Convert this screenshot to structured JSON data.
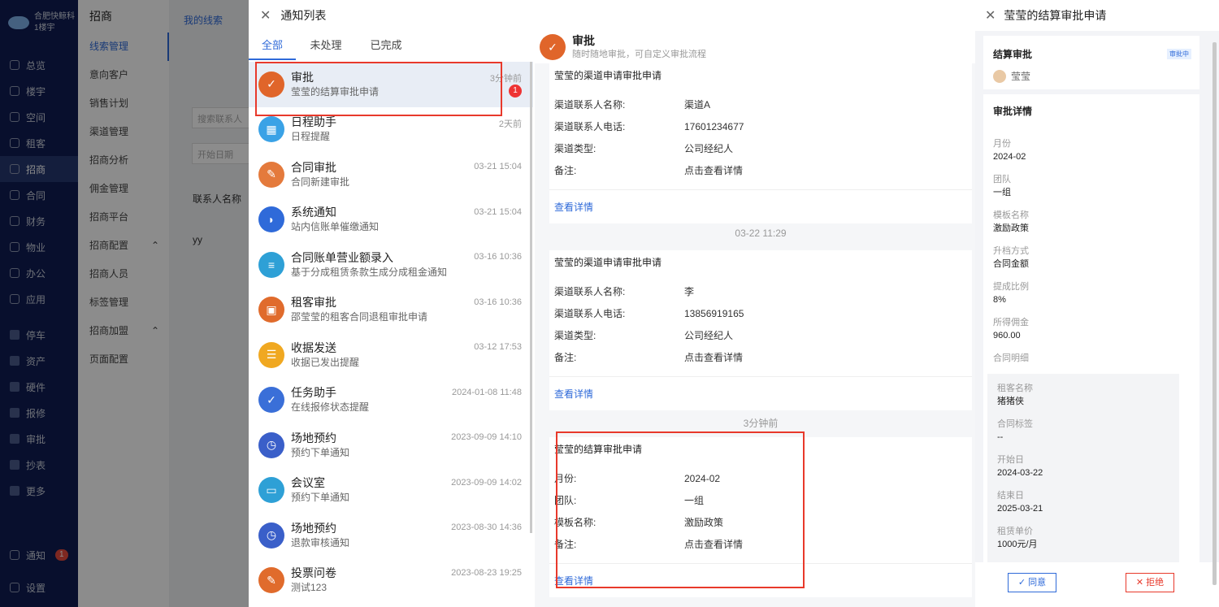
{
  "sidebar": {
    "org": "合肥快鲸科",
    "sub": "1楼宇",
    "items": [
      {
        "label": "总览",
        "icon": "dashboard-icon"
      },
      {
        "label": "楼宇",
        "icon": "building-icon"
      },
      {
        "label": "空间",
        "icon": "cube-icon"
      },
      {
        "label": "租客",
        "icon": "user-icon"
      },
      {
        "label": "招商",
        "icon": "tag-icon"
      },
      {
        "label": "合同",
        "icon": "contract-icon"
      },
      {
        "label": "财务",
        "icon": "finance-icon"
      },
      {
        "label": "物业",
        "icon": "home-icon"
      },
      {
        "label": "办公",
        "icon": "monitor-icon"
      },
      {
        "label": "应用",
        "icon": "app-icon"
      }
    ],
    "apps": [
      {
        "label": "停车"
      },
      {
        "label": "资产"
      },
      {
        "label": "硬件"
      },
      {
        "label": "报修"
      },
      {
        "label": "审批"
      },
      {
        "label": "抄表"
      },
      {
        "label": "更多"
      }
    ],
    "notify": "通知",
    "notify_count": "1",
    "settings": "设置"
  },
  "subnav": {
    "title": "招商",
    "items": [
      "线索管理",
      "意向客户",
      "销售计划",
      "渠道管理",
      "招商分析",
      "佣金管理",
      "招商平台"
    ],
    "group1": "招商配置",
    "g1items": [
      "招商人员",
      "标签管理"
    ],
    "group2": "招商加盟",
    "g2items": [
      "页面配置"
    ]
  },
  "main": {
    "tab": "我的线索",
    "search_ph": "搜索联系人",
    "date_ph": "开始日期",
    "col": "联系人名称",
    "cell": "yy"
  },
  "notif": {
    "title": "通知列表",
    "tabs": [
      "全部",
      "未处理",
      "已完成"
    ],
    "items": [
      {
        "title": "审批",
        "sub": "莹莹的结算审批申请",
        "time": "3分钟前",
        "badge": "1",
        "color": "#e0652a",
        "icon": "approval-icon"
      },
      {
        "title": "日程助手",
        "sub": "日程提醒",
        "time": "2天前",
        "color": "#3aa2e6",
        "icon": "calendar-icon"
      },
      {
        "title": "合同审批",
        "sub": "合同新建审批",
        "time": "03-21 15:04",
        "color": "#e47a3c",
        "icon": "contract-icon"
      },
      {
        "title": "系统通知",
        "sub": "站内信账单催缴通知",
        "time": "03-21 15:04",
        "color": "#2f6ad9",
        "icon": "whale-icon"
      },
      {
        "title": "合同账单营业额录入",
        "sub": "基于分成租赁条款生成分成租金通知",
        "time": "03-16 10:36",
        "color": "#2ea0d6",
        "icon": "layers-icon"
      },
      {
        "title": "租客审批",
        "sub": "邵莹莹的租客合同退租审批申请",
        "time": "03-16 10:36",
        "color": "#e06b2c",
        "icon": "tenant-icon"
      },
      {
        "title": "收据发送",
        "sub": "收据已发出提醒",
        "time": "03-12 17:53",
        "color": "#f0a821",
        "icon": "receipt-icon"
      },
      {
        "title": "任务助手",
        "sub": "在线报修状态提醒",
        "time": "2024-01-08 11:48",
        "color": "#3a6fd8",
        "icon": "check-icon"
      },
      {
        "title": "场地预约",
        "sub": "预约下单通知",
        "time": "2023-09-09 14:10",
        "color": "#3a5fc9",
        "icon": "calendar-clock-icon"
      },
      {
        "title": "会议室",
        "sub": "预约下单通知",
        "time": "2023-09-09 14:02",
        "color": "#2ea0d6",
        "icon": "meeting-icon"
      },
      {
        "title": "场地预约",
        "sub": "退款审核通知",
        "time": "2023-08-30 14:36",
        "color": "#3a5fc9",
        "icon": "calendar-clock-icon"
      },
      {
        "title": "投票问卷",
        "sub": "测试123",
        "time": "2023-08-23 19:25",
        "color": "#e06b2c",
        "icon": "vote-icon"
      }
    ]
  },
  "detail": {
    "title": "审批",
    "sub": "随时随地审批，可自定义审批流程",
    "card1": {
      "title": "莹莹的渠道申请审批申请",
      "rows": [
        [
          "渠道联系人名称:",
          "渠道A"
        ],
        [
          "渠道联系人电话:",
          "17601234677"
        ],
        [
          "渠道类型:",
          "公司经纪人"
        ],
        [
          "备注:",
          "点击查看详情"
        ]
      ],
      "link": "查看详情"
    },
    "time2": "03-22 11:29",
    "card2": {
      "title": "莹莹的渠道申请审批申请",
      "rows": [
        [
          "渠道联系人名称:",
          "李"
        ],
        [
          "渠道联系人电话:",
          "13856919165"
        ],
        [
          "渠道类型:",
          "公司经纪人"
        ],
        [
          "备注:",
          "点击查看详情"
        ]
      ],
      "link": "查看详情"
    },
    "time3": "3分钟前",
    "card3": {
      "title": "莹莹的结算审批申请",
      "rows": [
        [
          "月份:",
          "2024-02"
        ],
        [
          "团队:",
          "一组"
        ],
        [
          "模板名称:",
          "激励政策"
        ],
        [
          "备注:",
          "点击查看详情"
        ]
      ],
      "link": "查看详情"
    }
  },
  "right": {
    "title": "莹莹的结算审批申请",
    "card_title": "结算审批",
    "status": "审批中",
    "user": "莹莹",
    "detail_title": "审批详情",
    "fields": [
      [
        "月份",
        "2024-02"
      ],
      [
        "团队",
        "一组"
      ],
      [
        "模板名称",
        "激励政策"
      ],
      [
        "升档方式",
        "合同金额"
      ],
      [
        "提成比例",
        "8%"
      ],
      [
        "所得佣金",
        "960.00"
      ]
    ],
    "contract_label": "合同明细",
    "contract": [
      [
        "租客名称",
        "猪猪侠"
      ],
      [
        "合同标签",
        "--"
      ],
      [
        "开始日",
        "2024-03-22"
      ],
      [
        "结束日",
        "2025-03-21"
      ],
      [
        "租赁单价",
        "1000元/月"
      ]
    ],
    "agree": "同意",
    "reject": "拒绝"
  }
}
